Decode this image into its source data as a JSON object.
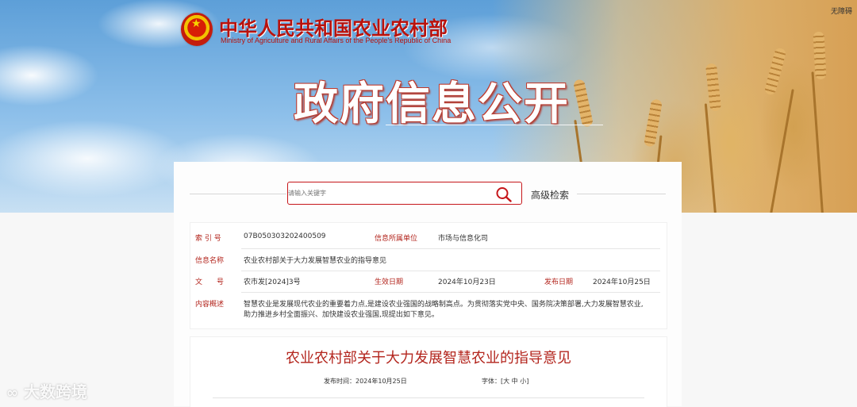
{
  "header": {
    "ministry_title": "中华人民共和国农业农村部",
    "ministry_en": "Ministry of Agriculture and Rural Affairs of the People's Republic of China",
    "accessibility_label": "无障碍",
    "page_heading": "政府信息公开"
  },
  "search": {
    "placeholder": "请输入关键字",
    "advanced_label": "高级检索"
  },
  "info": {
    "index_label": "索 引 号",
    "index_value": "07B050303202400509",
    "owner_label": "信息所属单位",
    "owner_value": "市场与信息化司",
    "name_label": "信息名称",
    "name_value": "农业农村部关于大力发展智慧农业的指导意见",
    "doc_label": "文　　号",
    "doc_value": "农市发[2024]3号",
    "effective_label": "生效日期",
    "effective_value": "2024年10月23日",
    "publish_label": "发布日期",
    "publish_value": "2024年10月25日",
    "summary_label": "内容概述",
    "summary_line1": "智慧农业是发展现代农业的重要着力点,是建设农业强国的战略制高点。为贯彻落实党中央、国务院决策部署,大力发展智慧农业,",
    "summary_line2": "助力推进乡村全面振兴、加快建设农业强国,现提出如下意见。"
  },
  "article": {
    "title": "农业农村部关于大力发展智慧农业的指导意见",
    "publish_time_label": "发布时间：",
    "publish_time_value": "2024年10月25日",
    "font_label": "字体：",
    "font_open": "[",
    "font_large": "大",
    "font_medium": "中",
    "font_small": "小",
    "font_close": "]"
  },
  "watermark": {
    "text": "大数跨境"
  },
  "colors": {
    "brand_red": "#b3251d",
    "search_border": "#c6161a"
  }
}
